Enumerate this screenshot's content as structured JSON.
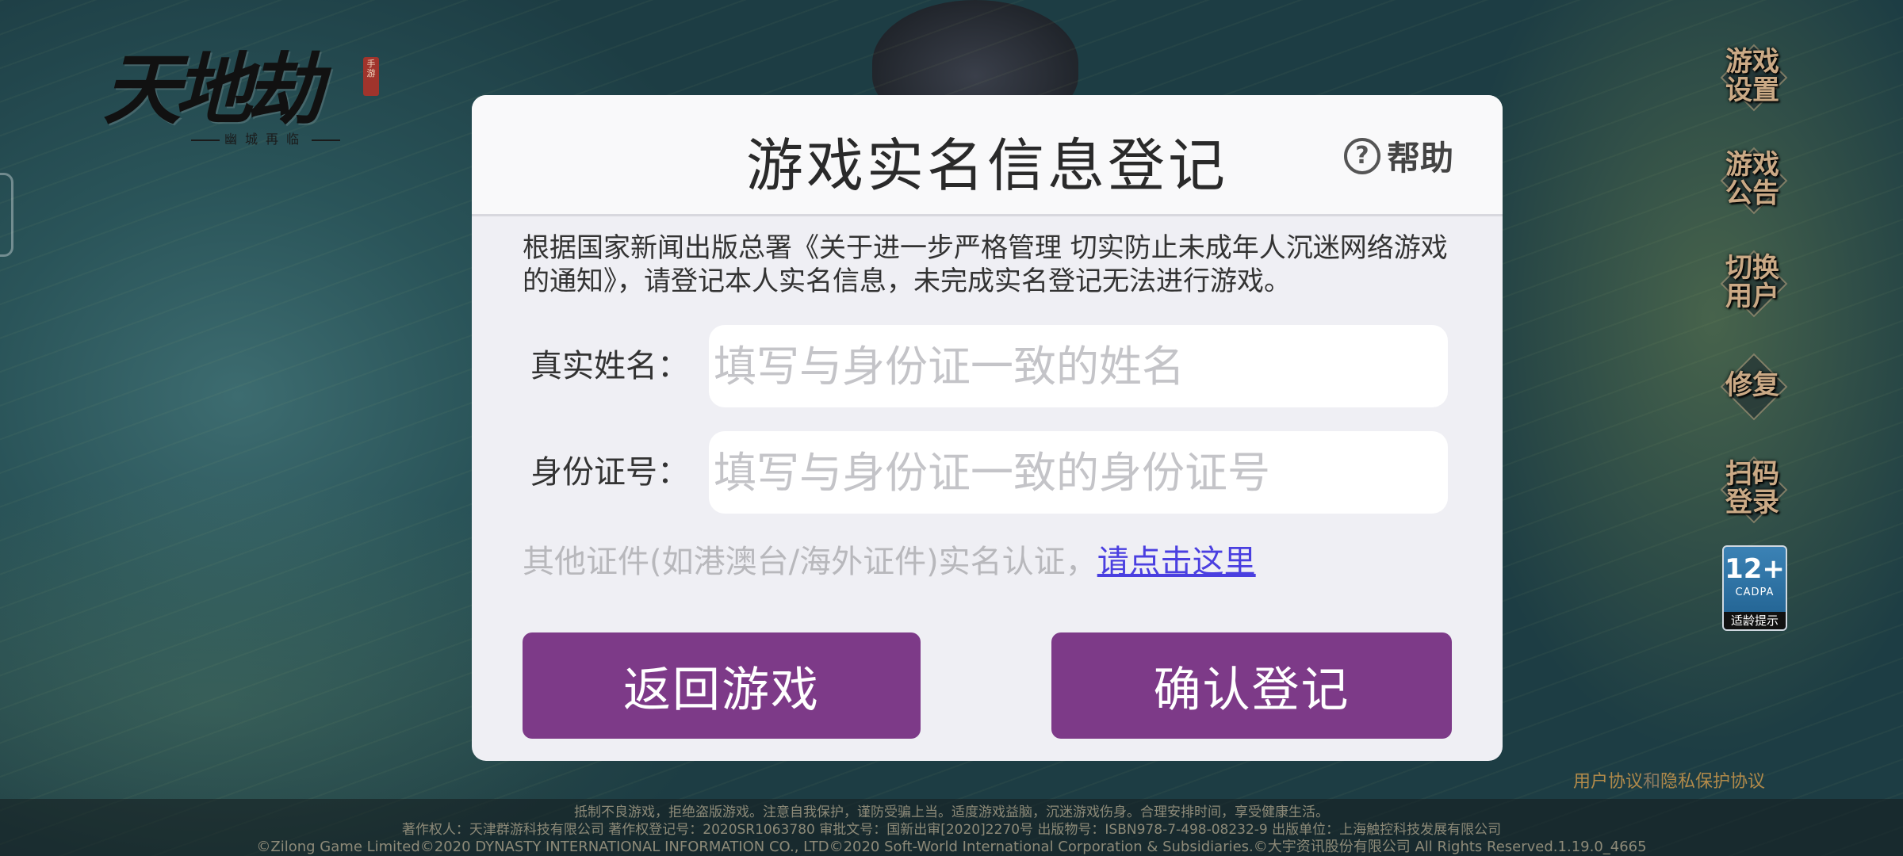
{
  "logo": {
    "title": "天地劫",
    "subtitle": "幽城再临",
    "seal": "手游"
  },
  "side_menu": [
    {
      "label": "游戏\n设置"
    },
    {
      "label": "游戏\n公告"
    },
    {
      "label": "切换\n用户"
    },
    {
      "label": "修复"
    },
    {
      "label": "扫码\n登录"
    }
  ],
  "age_badge": {
    "age": "12+",
    "org": "CADPA",
    "tip": "适龄提示"
  },
  "agreement": {
    "user_agreement": "用户协议",
    "and": "和",
    "privacy": "隐私保护协议"
  },
  "footer": {
    "line1": "抵制不良游戏，拒绝盗版游戏。注意自我保护，谨防受骗上当。适度游戏益脑，沉迷游戏伤身。合理安排时间，享受健康生活。",
    "line2": "著作权人：天津群游科技有限公司 著作权登记号：2020SR1063780 审批文号：国新出审[2020]2270号 出版物号：ISBN978-7-498-08232-9 出版单位：上海触控科技发展有限公司",
    "line3": "©Zilong Game Limited©2020 DYNASTY INTERNATIONAL INFORMATION CO., LTD©2020 Soft-World International Corporation & Subsidiaries.©大宇资讯股份有限公司 All Rights Reserved.1.19.0_4665"
  },
  "dialog": {
    "title": "游戏实名信息登记",
    "help_label": "帮助",
    "notice": "根据国家新闻出版总署《关于进一步严格管理 切实防止未成年人沉迷网络游戏的通知》，请登记本人实名信息，未完成实名登记无法进行游戏。",
    "name_label": "真实姓名：",
    "name_value": "",
    "name_placeholder": "填写与身份证一致的姓名",
    "id_label": "身份证号：",
    "id_value": "",
    "id_placeholder": "填写与身份证一致的身份证号",
    "other_cert_text": "其他证件(如港澳台/海外证件)实名认证，",
    "other_cert_link": "请点击这里",
    "back_button": "返回游戏",
    "confirm_button": "确认登记"
  },
  "colors": {
    "button": "#7d3a88",
    "link": "#4a3fe0",
    "agreement": "#b18a4a"
  }
}
